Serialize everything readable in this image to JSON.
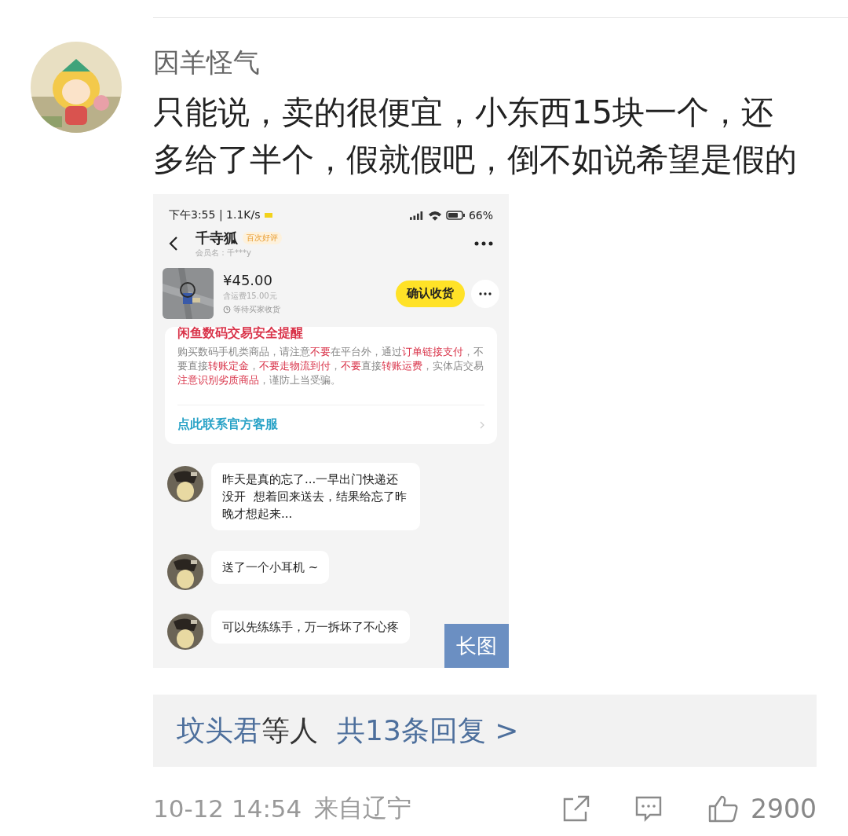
{
  "comment": {
    "author": "因羊怪气",
    "text": "只能说，卖的很便宜，小东西15块一个，还多给了半个，假就假吧，倒不如说希望是假的"
  },
  "attachment": {
    "badge": "长图",
    "status_bar": {
      "time": "下午3:55 | 1.1K/s",
      "battery": "66%"
    },
    "header": {
      "name": "千寺狐",
      "tag": "百次好评",
      "member": "会员名：千***y"
    },
    "order": {
      "price": "¥45.00",
      "shipping": "含运费15.00元",
      "status": "等待买家收货",
      "button": "确认收货"
    },
    "notice": {
      "title": "闲鱼数码交易安全提醒",
      "segments": [
        {
          "text": "购买数码手机类商品，请注意",
          "highlight": false
        },
        {
          "text": "不要",
          "highlight": true
        },
        {
          "text": "在平台外，通过",
          "highlight": false
        },
        {
          "text": "订单链接支付",
          "highlight": true
        },
        {
          "text": "，不要直接",
          "highlight": false
        },
        {
          "text": "转账定金",
          "highlight": true
        },
        {
          "text": "，",
          "highlight": false
        },
        {
          "text": "不要走物流到付",
          "highlight": true
        },
        {
          "text": "，",
          "highlight": false
        },
        {
          "text": "不要",
          "highlight": true
        },
        {
          "text": "直接",
          "highlight": false
        },
        {
          "text": "转账运费",
          "highlight": true
        },
        {
          "text": "，实体店交易",
          "highlight": false
        },
        {
          "text": "注意识别劣质商品",
          "highlight": true
        },
        {
          "text": "，谨防上当受骗。",
          "highlight": false
        }
      ],
      "link": "点此联系官方客服"
    },
    "messages": [
      {
        "text": "昨天是真的忘了...一早出门快递还没开  想着回来送去，结果给忘了昨晚才想起来..."
      },
      {
        "text": "送了一个小耳机 ~"
      },
      {
        "text": "可以先练练手，万一拆坏了不心疼"
      }
    ]
  },
  "replies": {
    "users": "坟头君",
    "others": "等人",
    "count": "共13条回复 >"
  },
  "footer": {
    "time": "10-12 14:54",
    "location": "来自辽宁",
    "likes": "2900"
  }
}
